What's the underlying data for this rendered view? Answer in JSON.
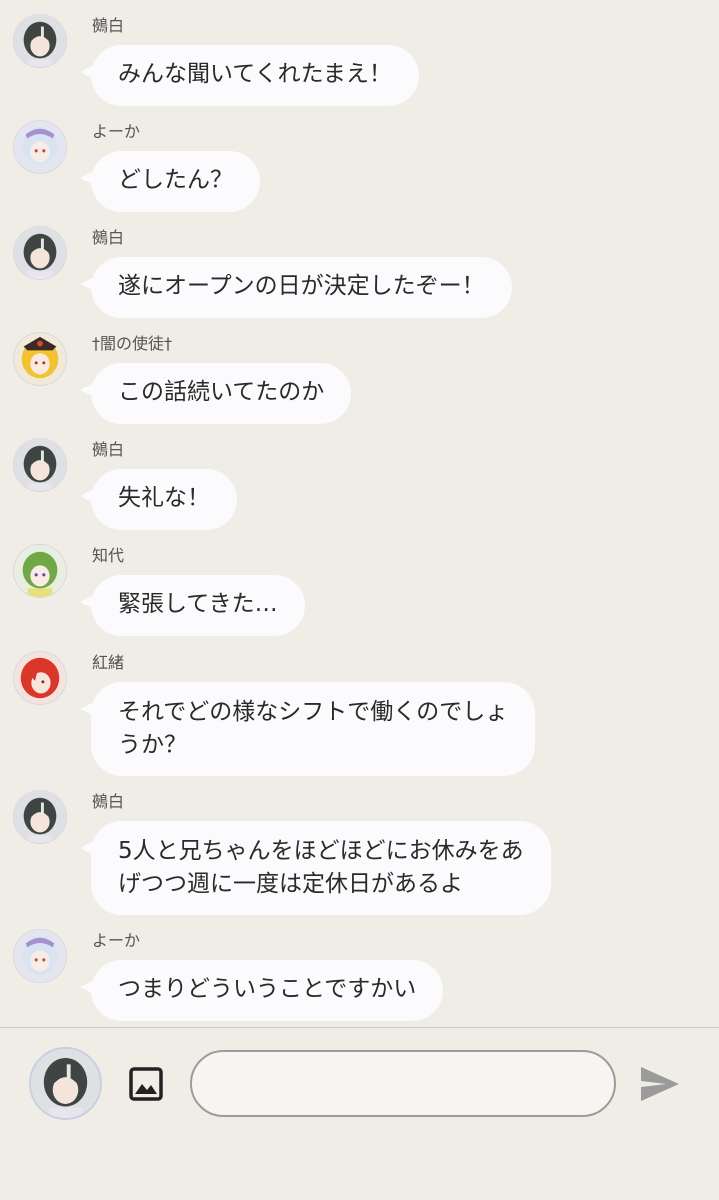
{
  "messages": [
    {
      "sender": "鵺白",
      "text": "みんな聞いてくれたまえ！",
      "avatar": "dark-hair-character-avatar"
    },
    {
      "sender": "よーか",
      "text": "どしたん？",
      "avatar": "white-hair-character-avatar"
    },
    {
      "sender": "鵺白",
      "text": "遂にオープンの日が決定したぞー！",
      "avatar": "dark-hair-character-avatar"
    },
    {
      "sender": "†闇の使徒†",
      "text": "この話続いてたのか",
      "avatar": "blonde-hair-character-avatar"
    },
    {
      "sender": "鵺白",
      "text": "失礼な！",
      "avatar": "dark-hair-character-avatar"
    },
    {
      "sender": "知代",
      "text": "緊張してきた…",
      "avatar": "green-hair-character-avatar"
    },
    {
      "sender": "紅緒",
      "text_lines": [
        "それでどの様なシフトで働くのでしょ",
        "うか？"
      ],
      "avatar": "red-hair-character-avatar"
    },
    {
      "sender": "鵺白",
      "text_lines": [
        "5人と兄ちゃんをほどほどにお休みをあ",
        "げつつ週に一度は定休日があるよ"
      ],
      "avatar": "dark-hair-character-avatar"
    },
    {
      "sender": "よーか",
      "text": "つまりどういうことですかい",
      "avatar": "white-hair-character-avatar"
    }
  ],
  "composer": {
    "input_value": "",
    "input_placeholder": "",
    "image_icon": "image-icon",
    "send_icon": "send-icon",
    "user_avatar": "dark-hair-character-avatar"
  },
  "colors": {
    "background": "#efede6",
    "bubble": "#fbfbfd",
    "text": "#2a2a2a",
    "name": "#555555",
    "send_icon": "#9b9b9b"
  }
}
